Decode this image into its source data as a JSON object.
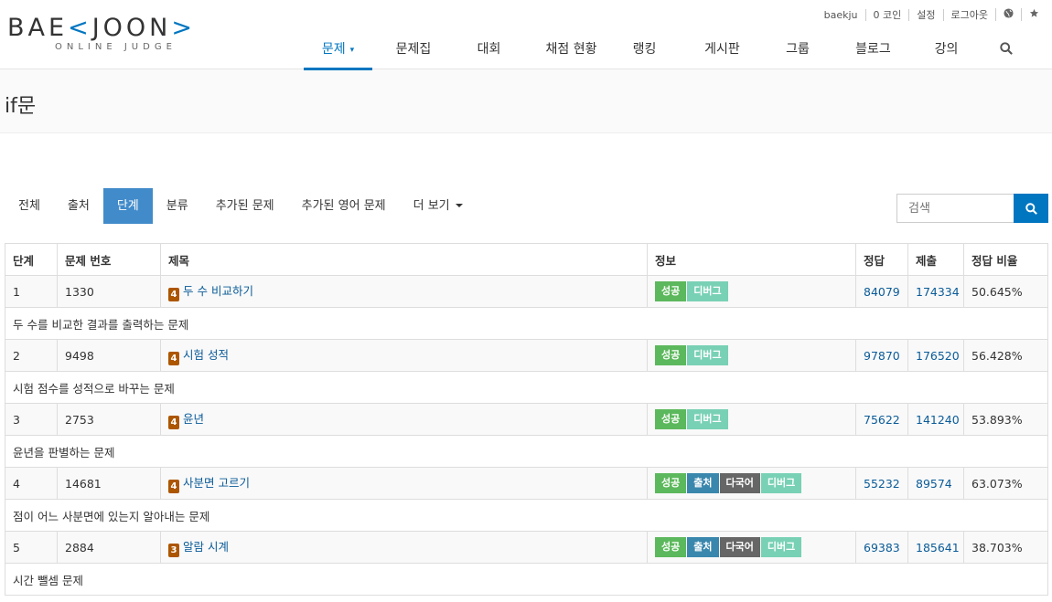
{
  "brand": {
    "logo_left": "BAE",
    "logo_bracket_left": "<",
    "logo_right": "JOON",
    "logo_bracket_right": ">",
    "logo_sub": "ONLINE JUDGE",
    "accent_color": "#0076c0"
  },
  "top_links": {
    "user": "baekju",
    "coins": "0 코인",
    "settings": "설정",
    "logout": "로그아웃",
    "icons": [
      "globe-icon",
      "star-icon"
    ]
  },
  "nav": {
    "items": [
      "문제",
      "문제집",
      "대회",
      "채점 현황",
      "랭킹",
      "게시판",
      "그룹",
      "블로그",
      "강의"
    ],
    "active": "문제",
    "icon": "search-icon"
  },
  "page": {
    "title": "if문"
  },
  "tabs": {
    "items": [
      "전체",
      "출처",
      "단계",
      "분류",
      "추가된 문제",
      "추가된 영어 문제",
      "더 보기"
    ],
    "active": "단계"
  },
  "search": {
    "placeholder": "검색"
  },
  "table": {
    "headers": [
      "단계",
      "문제 번호",
      "제목",
      "정보",
      "정답",
      "제출",
      "정답 비율"
    ],
    "rows": [
      {
        "step": "1",
        "id": "1330",
        "tier": "4",
        "title": "두 수 비교하기",
        "labels": [
          "성공",
          "디버그"
        ],
        "correct": "84079",
        "submit": "174334",
        "ratio": "50.645%",
        "desc": "두 수를 비교한 결과를 출력하는 문제"
      },
      {
        "step": "2",
        "id": "9498",
        "tier": "4",
        "title": "시험 성적",
        "labels": [
          "성공",
          "디버그"
        ],
        "correct": "97870",
        "submit": "176520",
        "ratio": "56.428%",
        "desc": "시험 점수를 성적으로 바꾸는 문제"
      },
      {
        "step": "3",
        "id": "2753",
        "tier": "4",
        "title": "윤년",
        "labels": [
          "성공",
          "디버그"
        ],
        "correct": "75622",
        "submit": "141240",
        "ratio": "53.893%",
        "desc": "윤년을 판별하는 문제"
      },
      {
        "step": "4",
        "id": "14681",
        "tier": "4",
        "title": "사분면 고르기",
        "labels": [
          "성공",
          "출처",
          "다국어",
          "디버그"
        ],
        "correct": "55232",
        "submit": "89574",
        "ratio": "63.073%",
        "desc": "점이 어느 사분면에 있는지 알아내는 문제"
      },
      {
        "step": "5",
        "id": "2884",
        "tier": "3",
        "title": "알람 시계",
        "labels": [
          "성공",
          "출처",
          "다국어",
          "디버그"
        ],
        "correct": "69383",
        "submit": "185641",
        "ratio": "38.703%",
        "desc": "시간 뺄셈 문제"
      }
    ]
  }
}
